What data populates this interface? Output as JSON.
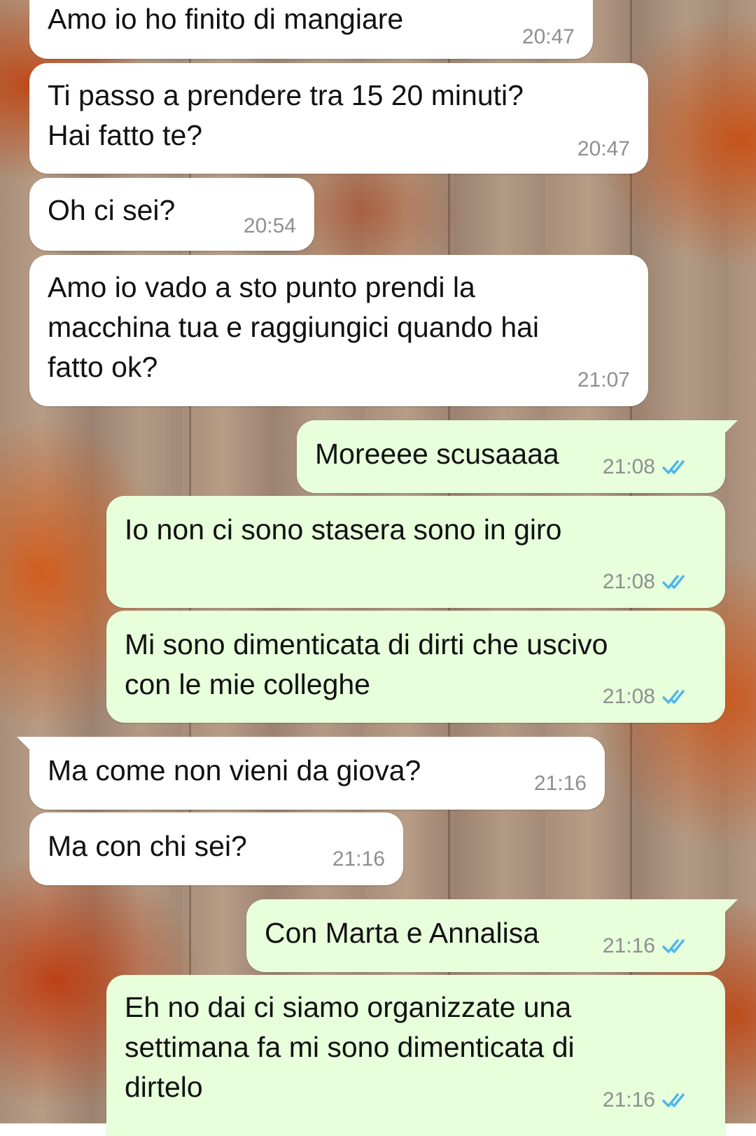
{
  "colors": {
    "incoming_bubble": "#ffffff",
    "outgoing_bubble": "#e7ffdb",
    "time_text": "#8f8f8f",
    "read_ticks": "#4fb6ec"
  },
  "messages": [
    {
      "direction": "in",
      "text": "Amo io ho finito di mangiare",
      "time": "20:47"
    },
    {
      "direction": "in",
      "text": "Ti passo a prendere tra 15 20 minuti?\nHai fatto te?",
      "time": "20:47"
    },
    {
      "direction": "in",
      "text": "Oh ci sei?",
      "time": "20:54"
    },
    {
      "direction": "in",
      "text": "Amo io vado a sto punto prendi la\nmacchina tua e raggiungici quando hai\nfatto ok?",
      "time": "21:07"
    },
    {
      "direction": "out",
      "text": "Moreeee scusaaaa",
      "time": "21:08",
      "status_icon": "double-check-read-icon"
    },
    {
      "direction": "out",
      "text": "Io non ci sono stasera sono in giro",
      "time": "21:08",
      "status_icon": "double-check-read-icon"
    },
    {
      "direction": "out",
      "text": "Mi sono dimenticata di dirti che uscivo\ncon le mie colleghe",
      "time": "21:08",
      "status_icon": "double-check-read-icon"
    },
    {
      "direction": "in",
      "text": "Ma come non vieni da giova?",
      "time": "21:16"
    },
    {
      "direction": "in",
      "text": "Ma con chi sei?",
      "time": "21:16"
    },
    {
      "direction": "out",
      "text": "Con Marta e Annalisa",
      "time": "21:16",
      "status_icon": "double-check-read-icon"
    },
    {
      "direction": "out",
      "text": "Eh no dai ci siamo organizzate una\nsettimana fa mi sono dimenticata di\ndirtelo",
      "time": "21:16",
      "status_icon": "double-check-read-icon"
    }
  ]
}
